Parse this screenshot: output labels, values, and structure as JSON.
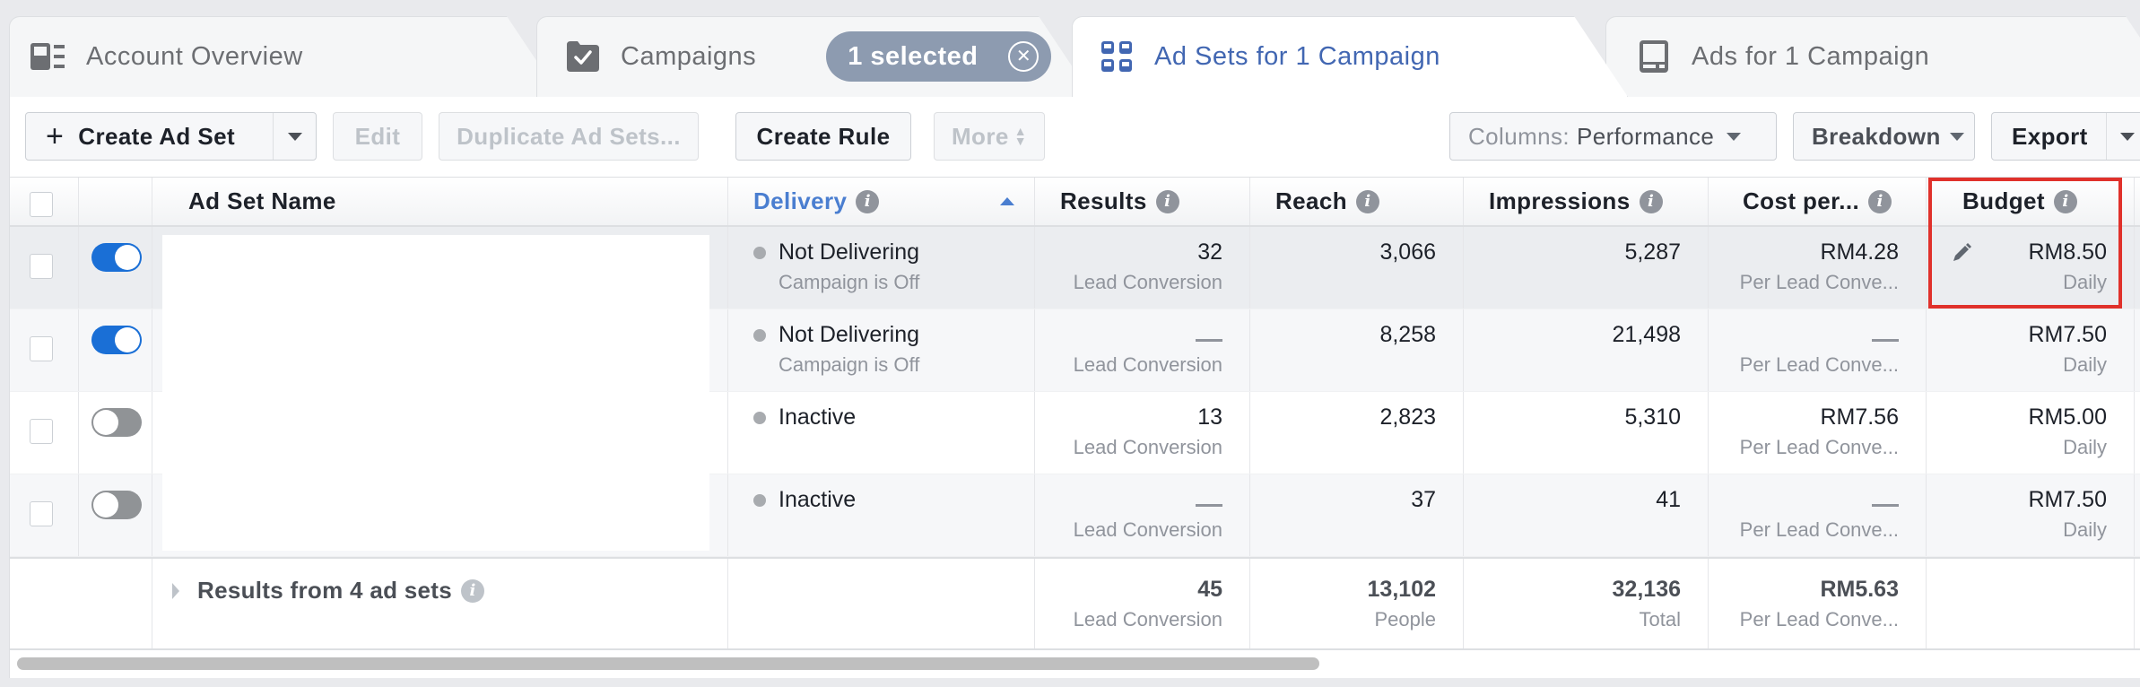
{
  "tabs": [
    {
      "label": "Account Overview",
      "icon": "account-overview-icon",
      "active": false
    },
    {
      "label": "Campaigns",
      "icon": "campaign-folder-check-icon",
      "active": false,
      "selection_pill": "1 selected"
    },
    {
      "label": "Ad Sets for 1 Campaign",
      "icon": "ad-sets-grid-icon",
      "active": true
    },
    {
      "label": "Ads for 1 Campaign",
      "icon": "ads-icon",
      "active": false
    }
  ],
  "toolbar": {
    "create": "Create Ad Set",
    "edit": "Edit",
    "duplicate": "Duplicate Ad Sets...",
    "create_rule": "Create Rule",
    "more": "More",
    "columns_prefix": "Columns:",
    "columns_value": "Performance",
    "breakdown": "Breakdown",
    "export": "Export"
  },
  "columns": {
    "name": "Ad Set Name",
    "delivery": "Delivery",
    "results": "Results",
    "reach": "Reach",
    "impressions": "Impressions",
    "cost": "Cost per...",
    "budget": "Budget"
  },
  "rows": [
    {
      "toggle": "on",
      "delivery": "Not Delivering",
      "delivery_sub": "Campaign is Off",
      "results": "32",
      "results_sub": "Lead Conversion",
      "reach": "3,066",
      "impressions": "5,287",
      "cost": "RM4.28",
      "cost_sub": "Per Lead Conve...",
      "budget": "RM8.50",
      "budget_sub": "Daily"
    },
    {
      "toggle": "on",
      "delivery": "Not Delivering",
      "delivery_sub": "Campaign is Off",
      "results": "—",
      "results_sub": "Lead Conversion",
      "reach": "8,258",
      "impressions": "21,498",
      "cost": "—",
      "cost_sub": "Per Lead Conve...",
      "budget": "RM7.50",
      "budget_sub": "Daily"
    },
    {
      "toggle": "off",
      "delivery": "Inactive",
      "delivery_sub": "",
      "results": "13",
      "results_sub": "Lead Conversion",
      "reach": "2,823",
      "impressions": "5,310",
      "cost": "RM7.56",
      "cost_sub": "Per Lead Conve...",
      "budget": "RM5.00",
      "budget_sub": "Daily"
    },
    {
      "toggle": "off",
      "delivery": "Inactive",
      "delivery_sub": "",
      "results": "—",
      "results_sub": "Lead Conversion",
      "reach": "37",
      "impressions": "41",
      "cost": "—",
      "cost_sub": "Per Lead Conve...",
      "budget": "RM7.50",
      "budget_sub": "Daily"
    }
  ],
  "totals": {
    "label": "Results from 4 ad sets",
    "results": "45",
    "results_sub": "Lead Conversion",
    "reach": "13,102",
    "reach_sub": "People",
    "impressions": "32,136",
    "impressions_sub": "Total",
    "cost": "RM5.63",
    "cost_sub": "Per Lead Conve..."
  },
  "colors": {
    "accent": "#4267b2",
    "toggle_on": "#1a6fd6",
    "highlight_box": "#e0312b",
    "pill": "#8d9bb0"
  }
}
